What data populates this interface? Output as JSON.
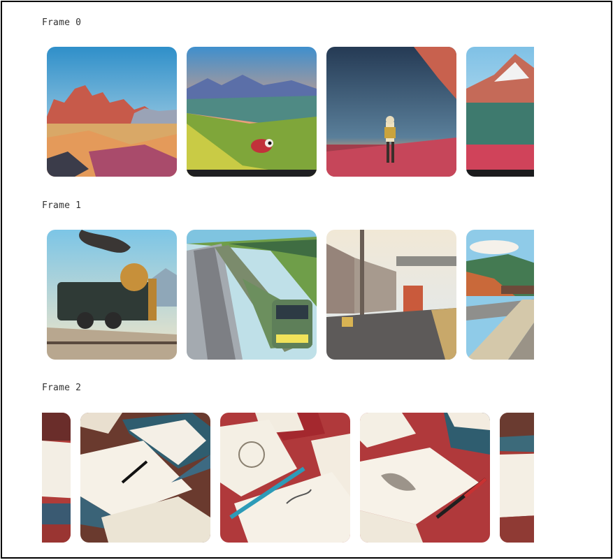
{
  "frames": [
    {
      "label": "Frame 0",
      "theme": "landscapes",
      "tiles": [
        {
          "name": "red-mesa-desert-image"
        },
        {
          "name": "meadow-creature-image"
        },
        {
          "name": "hiker-at-dusk-image"
        },
        {
          "name": "mountain-hiker-image"
        }
      ]
    },
    {
      "label": "Frame 1",
      "theme": "trains",
      "tiles": [
        {
          "name": "steam-locomotive-image"
        },
        {
          "name": "modern-train-image"
        },
        {
          "name": "station-platform-image"
        },
        {
          "name": "curved-railway-image"
        }
      ]
    },
    {
      "label": "Frame 2",
      "theme": "books",
      "tiles": [
        {
          "name": "book-stack-image"
        },
        {
          "name": "open-notebook-pen-image"
        },
        {
          "name": "sketchbook-pencil-image"
        },
        {
          "name": "open-book-drawing-image"
        },
        {
          "name": "scattered-books-image"
        }
      ]
    }
  ],
  "colors": {
    "border": "#000000",
    "background": "#ffffff",
    "label_text": "#333333"
  }
}
